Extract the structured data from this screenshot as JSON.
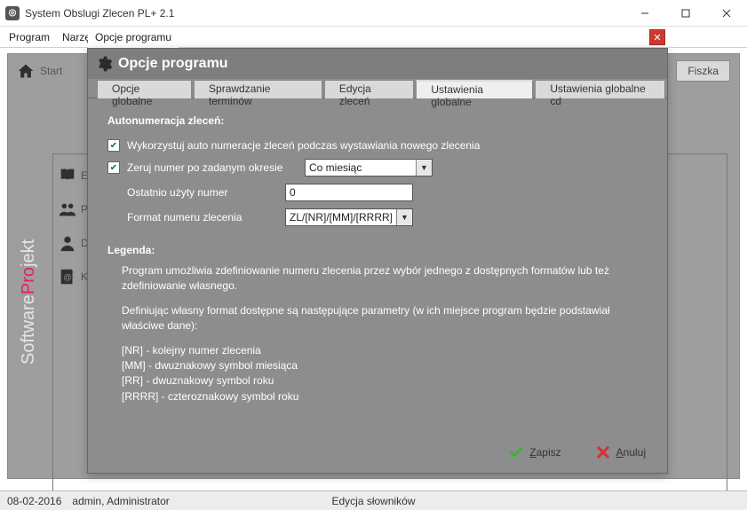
{
  "window": {
    "title": "System Obslugi Zlecen PL+ 2.1"
  },
  "menu": {
    "program": "Program",
    "narz": "Narzę",
    "breadcrumb": "Opcje programu"
  },
  "toolbar": {
    "start": "Start",
    "fiszka": "Fiszka"
  },
  "sidebar": {
    "items": [
      {
        "letter": "E"
      },
      {
        "letter": "P"
      },
      {
        "letter": "D"
      },
      {
        "letter": "K"
      }
    ]
  },
  "dialog": {
    "title": "Opcje programu",
    "tabs": [
      {
        "label": "Opcje globalne"
      },
      {
        "label": "Sprawdzanie terminów"
      },
      {
        "label": "Edycja zleceń"
      },
      {
        "label": "Ustawienia globalne",
        "active": true
      },
      {
        "label": "Ustawienia globalne cd"
      }
    ],
    "section_title": "Autonumeracja zleceń:",
    "chk1_label": "Wykorzystuj auto numeracje zleceń podczas wystawiania nowego zlecenia",
    "chk2_label": "Zeruj numer po zadanym okresie",
    "select_period": "Co miesiąc",
    "last_used_label": "Ostatnio użyty numer",
    "last_used_value": "0",
    "format_label": "Format numeru zlecenia",
    "format_value": "ZL/[NR]/[MM]/[RRRR]",
    "legend_title": "Legenda:",
    "legend_p1": "Program umożliwia zdefiniowanie numeru zlecenia przez wybór jednego z dostępnych formatów lub też zdefiniowanie własnego.",
    "legend_p2": "Definiując własny format dostępne są następujące parametry (w ich miejsce program będzie podstawiał właściwe dane):",
    "legend_nr": "[NR] - kolejny numer zlecenia",
    "legend_mm": "[MM] - dwuznakowy symbol miesiąca",
    "legend_rr": "[RR] - dwuznakowy symbol roku",
    "legend_rrrr": "[RRRR] - czteroznakowy symbol roku",
    "save_label": "Zapisz",
    "cancel_label": "Anuluj"
  },
  "statusbar": {
    "date": "08-02-2016",
    "user": "admin, Administrator",
    "center": "Edycja słowników"
  }
}
